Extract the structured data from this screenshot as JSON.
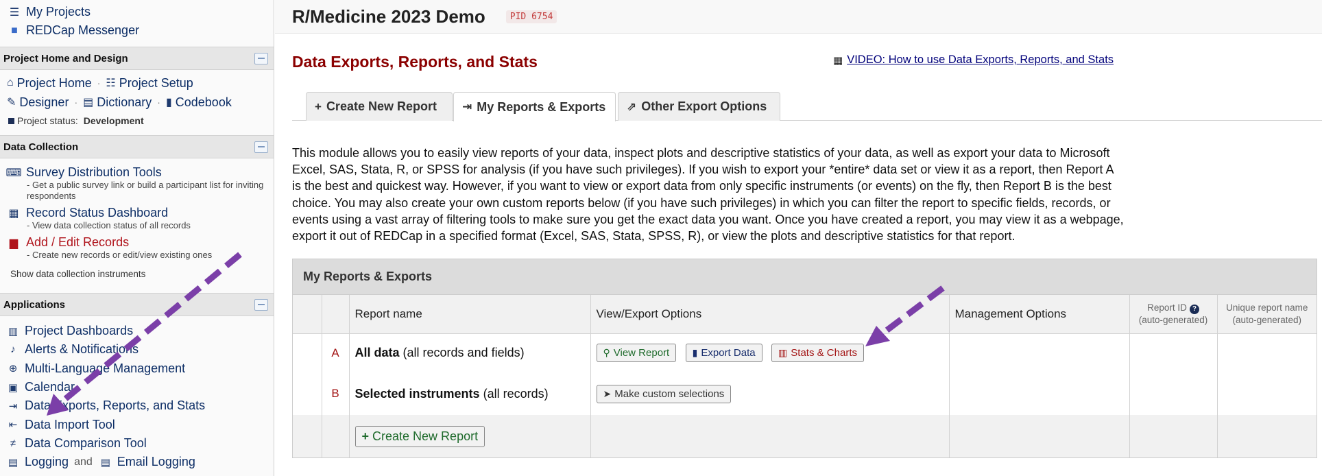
{
  "sidebar": {
    "top_links": [
      {
        "icon": "list-icon",
        "label": "My Projects"
      },
      {
        "icon": "chat-icon",
        "label": "REDCap Messenger"
      }
    ],
    "project_home": {
      "heading": "Project Home and Design",
      "links": {
        "project_home": "Project Home",
        "project_setup": "Project Setup",
        "designer": "Designer",
        "dictionary": "Dictionary",
        "codebook": "Codebook"
      },
      "separator": "·",
      "status_label": "Project status:",
      "status_value": "Development"
    },
    "data_collection": {
      "heading": "Data Collection",
      "items": [
        {
          "label": "Survey Distribution Tools",
          "desc": "- Get a public survey link or build a participant list for inviting respondents"
        },
        {
          "label": "Record Status Dashboard",
          "desc": "- View data collection status of all records"
        },
        {
          "label": "Add / Edit Records",
          "desc": "- Create new records or edit/view existing ones"
        }
      ],
      "show_instruments": "Show data collection instruments"
    },
    "applications": {
      "heading": "Applications",
      "items": [
        {
          "label": "Project Dashboards",
          "icon": "dashboard-icon"
        },
        {
          "label": "Alerts & Notifications",
          "icon": "bell-icon"
        },
        {
          "label": "Multi-Language Management",
          "icon": "globe-icon"
        },
        {
          "label": "Calendar",
          "icon": "calendar-icon"
        },
        {
          "label": "Data Exports, Reports, and Stats",
          "icon": "export-icon"
        },
        {
          "label": "Data Import Tool",
          "icon": "import-icon"
        },
        {
          "label": "Data Comparison Tool",
          "icon": "compare-icon"
        }
      ],
      "last_row": {
        "left": "Logging",
        "and": "and",
        "right": "Email Logging"
      }
    }
  },
  "header": {
    "project_title": "R/Medicine 2023 Demo",
    "pid": "PID 6754"
  },
  "main": {
    "page_title": "Data Exports, Reports, and Stats",
    "video_link": "VIDEO: How to use Data Exports, Reports, and Stats",
    "tabs": [
      {
        "label": "Create New Report",
        "icon": "plus-icon"
      },
      {
        "label": "My Reports & Exports",
        "icon": "export-icon"
      },
      {
        "label": "Other Export Options",
        "icon": "share-icon"
      }
    ],
    "intro": "This module allows you to easily view reports of your data, inspect plots and descriptive statistics of your data, as well as export your data to Microsoft Excel, SAS, Stata, R, or SPSS for analysis (if you have such privileges). If you wish to export your *entire* data set or view it as a report, then Report A is the best and quickest way. However, if you want to view or export data from only specific instruments (or events) on the fly, then Report B is the best choice. You may also create your own custom reports below (if you have such privileges) in which you can filter the report to specific fields, records, or events using a vast array of filtering tools to make sure you get the exact data you want. Once you have created a report, you may view it as a webpage, export it out of REDCap in a specified format (Excel, SAS, Stata, SPSS, R), or view the plots and descriptive statistics for that report."
  },
  "reports_table": {
    "title": "My Reports & Exports",
    "columns": {
      "report_name": "Report name",
      "view_export": "View/Export Options",
      "management": "Management Options",
      "report_id": "Report ID",
      "report_id_sub": "(auto-generated)",
      "unique_name": "Unique report name",
      "unique_name_sub": "(auto-generated)"
    },
    "rows": [
      {
        "letter": "A",
        "name_bold": "All data",
        "name_rest": "(all records and fields)"
      },
      {
        "letter": "B",
        "name_bold": "Selected instruments",
        "name_rest": "(all records)"
      }
    ],
    "buttons": {
      "view_report": "View Report",
      "export_data": "Export Data",
      "stats_charts": "Stats & Charts",
      "custom_selections": "Make custom selections",
      "create_new_report": "Create New Report"
    }
  },
  "colors": {
    "annotation_arrow": "#7b3fa8",
    "page_title": "#8b0000",
    "link": "#0d2e66"
  }
}
